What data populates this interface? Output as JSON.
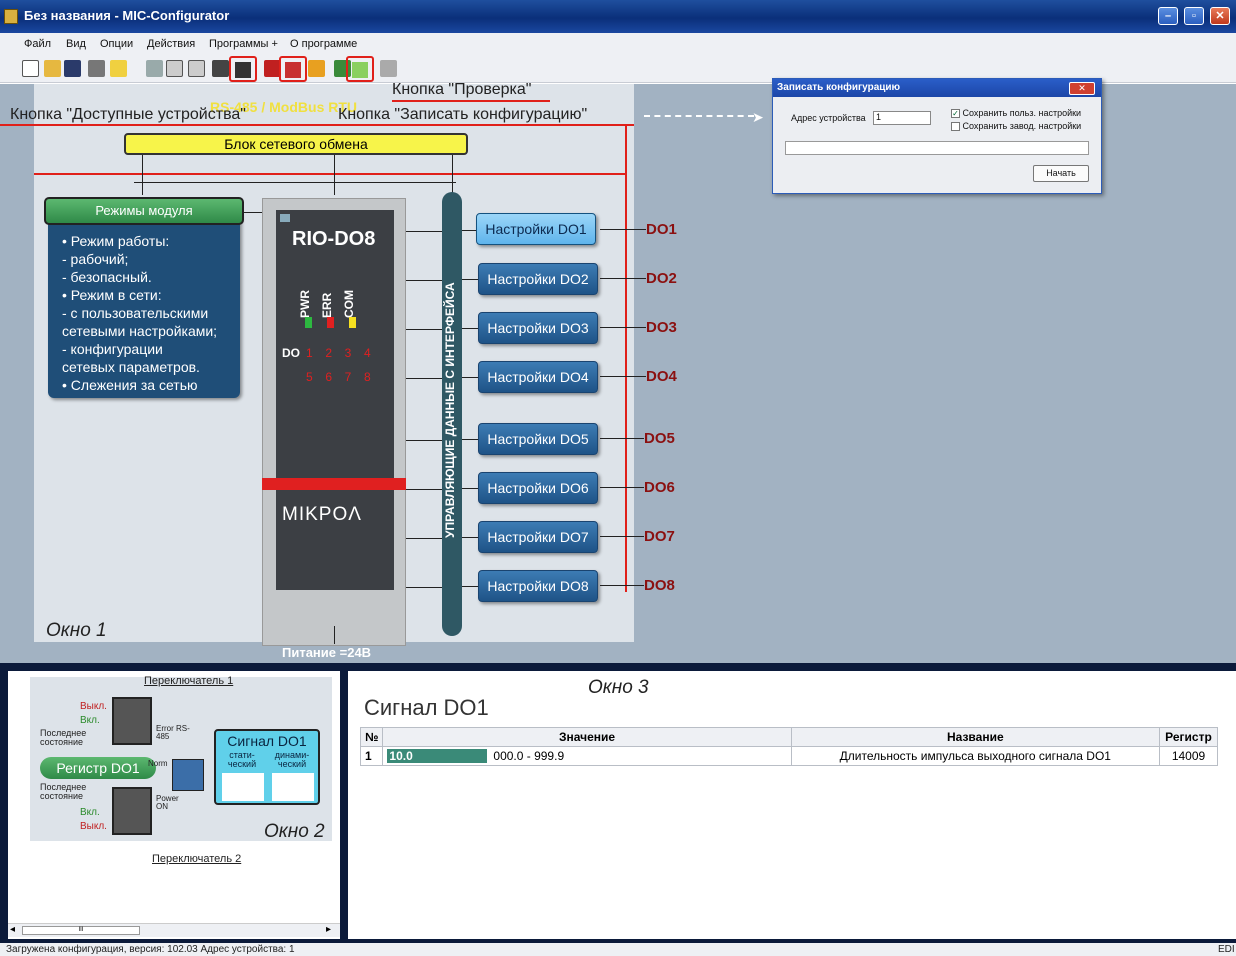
{
  "window": {
    "title": "Без названия - MIC-Configurator",
    "btn_min": "–",
    "btn_max": "▫",
    "btn_close": "✕"
  },
  "menu": [
    "Файл",
    "Вид",
    "Опции",
    "Действия",
    "Программы +",
    "О программе"
  ],
  "annotations": {
    "check_btn": "Кнопка \"Проверка\"",
    "available_devices": "Кнопка \"Доступные устройства\"",
    "write_config": "Кнопка \"Записать конфигурацию\"",
    "protocol": "RS-485 / ModBus RTU",
    "window1": "Окно 1",
    "window2": "Окно 2",
    "window3": "Окно 3"
  },
  "diagram": {
    "network_block": "Блок сетевого обмена",
    "modes_header": "Режимы модуля",
    "modes_lines": [
      "• Режим работы:",
      "  - рабочий;",
      "  - безопасный.",
      "• Режим в сети:",
      "  - с пользовательскими",
      "сетевыми настройками;",
      "  - конфигурации",
      "сетевых параметров.",
      "• Слежения за сетью"
    ],
    "device_name": "RIO-DO8",
    "leds": [
      "PWR",
      "ERR",
      "COM"
    ],
    "do_label": "DO",
    "do_row1": "1  2  3  4",
    "do_row2": "5  6  7  8",
    "brand": "MIKPOΛ",
    "bus_label": "УПРАВЛЯЮЩИЕ ДАННЫЕ С ИНТЕРФЕЙСА",
    "power": "Питание =24В",
    "do_buttons": [
      "Настройки DO1",
      "Настройки DO2",
      "Настройки DO3",
      "Настройки DO4",
      "Настройки DO5",
      "Настройки DO6",
      "Настройки DO7",
      "Настройки DO8"
    ],
    "do_outputs": [
      "DO1",
      "DO2",
      "DO3",
      "DO4",
      "DO5",
      "DO6",
      "DO7",
      "DO8"
    ]
  },
  "dialog": {
    "title": "Записать конфигурацию",
    "address_label": "Адрес устройства",
    "address_value": "1",
    "save_user": "Сохранить польз. настройки",
    "save_factory": "Сохранить завод. настройки",
    "start": "Начать",
    "close": "✕"
  },
  "pane2": {
    "switch1": "Переключатель 1",
    "switch2": "Переключатель 2",
    "off": "Выкл.",
    "on": "Вкл.",
    "last_state": "Последнее состояние",
    "error": "Error RS-485",
    "norm": "Norm",
    "power_on": "Power ON",
    "register": "Регистр DO1",
    "signal": "Сигнал DO1",
    "static": "стати-ческий",
    "dynamic": "динами-ческий",
    "scroll_left": "◂",
    "scroll_right": "▸",
    "scroll_thumb": "III"
  },
  "pane3": {
    "heading": "Сигнал DO1",
    "columns": [
      "№",
      "Значение",
      "Название",
      "Регистр"
    ],
    "rows": [
      {
        "n": "1",
        "value": "10.0",
        "range": "000.0 - 999.9",
        "name": "Длительность импульса выходного сигнала DO1",
        "reg": "14009"
      }
    ]
  },
  "status": {
    "text": "Загружена конфигурация, версия: 102.03 Адрес устройства: 1",
    "right": "EDI"
  }
}
